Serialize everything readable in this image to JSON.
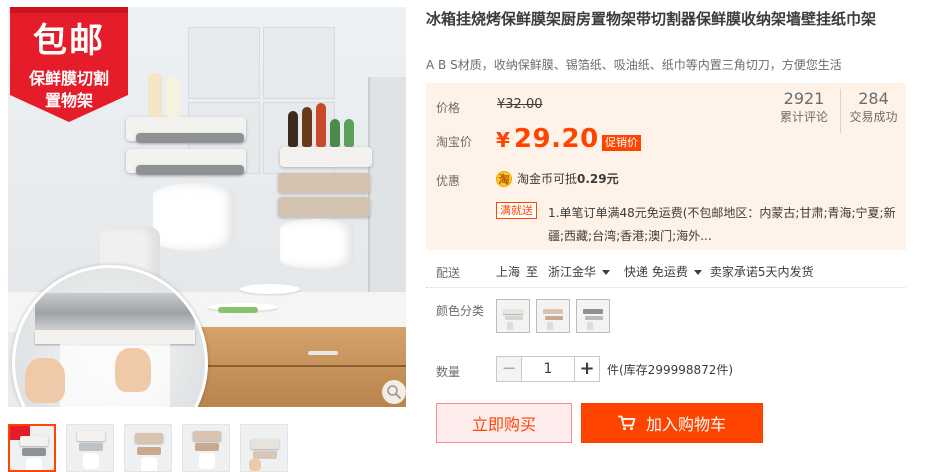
{
  "gallery": {
    "promo": {
      "line1": "包邮",
      "line2": "保鲜膜切割",
      "line3": "置物架"
    },
    "zoom_icon": "zoom-icon",
    "thumbnails": [
      {
        "label": "thumbnail-1",
        "active": true
      },
      {
        "label": "thumbnail-2",
        "active": false
      },
      {
        "label": "thumbnail-3",
        "active": false
      },
      {
        "label": "thumbnail-4",
        "active": false
      },
      {
        "label": "thumbnail-5",
        "active": false
      }
    ]
  },
  "product": {
    "title": "冰箱挂烧烤保鲜膜架厨房置物架带切割器保鲜膜收纳架墙壁挂纸巾架",
    "subtitle": "A B S材质，收纳保鲜膜、锡箔纸、吸油纸、纸巾等内置三角切刀，方便您生活"
  },
  "pricing": {
    "price_label": "价格",
    "original_price": "¥32.00",
    "taobao_label": "淘宝价",
    "currency": "¥",
    "current_price": "29.20",
    "promo_tag": "促销价",
    "stats": [
      {
        "value": "2921",
        "label": "累计评论"
      },
      {
        "value": "284",
        "label": "交易成功"
      }
    ],
    "benefit_label": "优惠",
    "coin_glyph": "淘",
    "coin_text_prefix": "淘金币可抵",
    "coin_amount": "0.29元",
    "manjiu_tag": "满就送",
    "manjiu_text": "1.单笔订单满48元免运费(不包邮地区：内蒙古;甘肃;青海;宁夏;新疆;西藏;台湾;香港;澳门;海外..."
  },
  "shipping": {
    "label": "配送",
    "from": "上海",
    "to_word": "至",
    "destination": "浙江金华",
    "method": "快递 免运费",
    "promise": "卖家承诺5天内发货"
  },
  "color": {
    "label": "颜色分类",
    "options": [
      {
        "name": "color-option-white",
        "colors": [
          "#e8e4e0",
          "#d9d4ce"
        ]
      },
      {
        "name": "color-option-beige",
        "colors": [
          "#d9c4b0",
          "#c8a98f"
        ]
      },
      {
        "name": "color-option-grey",
        "colors": [
          "#8d9194",
          "#b7bbbd"
        ]
      }
    ]
  },
  "quantity": {
    "label": "数量",
    "minus": "−",
    "value": "1",
    "plus": "+",
    "stock": "件(库存299998872件)"
  },
  "actions": {
    "buy_now": "立即购买",
    "add_to_cart": "加入购物车",
    "cart_icon": "cart-icon"
  },
  "colors": {
    "accent": "#ff4400",
    "price_bg": "#fff2e8",
    "buy_bg": "#ffeded"
  }
}
